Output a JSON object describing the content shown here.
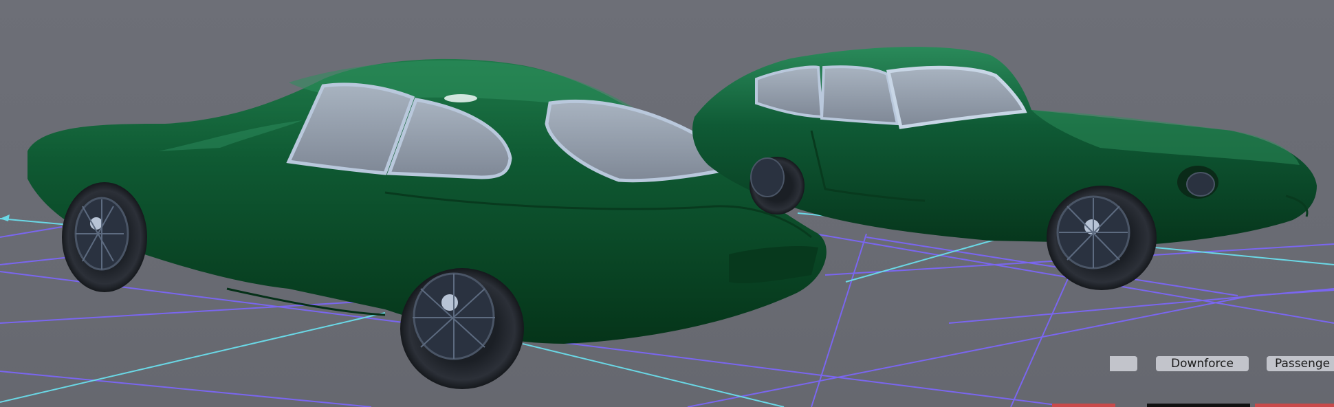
{
  "viewport": {
    "background_color": "#6b6d75",
    "grid_color": "#7a66f0",
    "axis_color": "#6ad8e6",
    "car_paint_color": "#0c4a26"
  },
  "toolbar": {
    "buttons": [
      {
        "label": ""
      },
      {
        "label": "Downforce"
      },
      {
        "label": "Passenge"
      }
    ]
  },
  "bottom_strip": {
    "colors": [
      "#c94a4a",
      "#111111",
      "#c94a4a"
    ]
  }
}
